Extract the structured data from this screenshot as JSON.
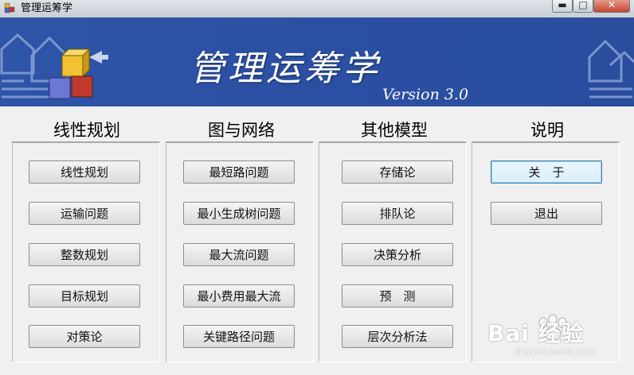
{
  "window": {
    "title": "管理运筹学",
    "controls": {
      "minimize": "▬",
      "maximize": "□",
      "close": "✕"
    }
  },
  "banner": {
    "title": "管理运筹学",
    "version": "Version 3.0"
  },
  "sections": {
    "linear": {
      "title": "线性规划",
      "buttons": [
        "线性规划",
        "运输问题",
        "整数规划",
        "目标规划",
        "对策论"
      ]
    },
    "graph": {
      "title": "图与网络",
      "buttons": [
        "最短路问题",
        "最小生成树问题",
        "最大流问题",
        "最小费用最大流",
        "关键路径问题"
      ]
    },
    "other": {
      "title": "其他模型",
      "buttons": [
        "存储论",
        "排队论",
        "决策分析",
        "预　测",
        "层次分析法"
      ]
    },
    "about": {
      "title": "说明",
      "buttons": [
        "关　于",
        "退出"
      ]
    }
  },
  "watermark": {
    "brand": "Bai  经验",
    "url": "jingyan.baidu.com"
  },
  "colors": {
    "banner": "#2b4fa3",
    "window_bg": "#f0f0f0",
    "close_button": "#c4432f"
  }
}
